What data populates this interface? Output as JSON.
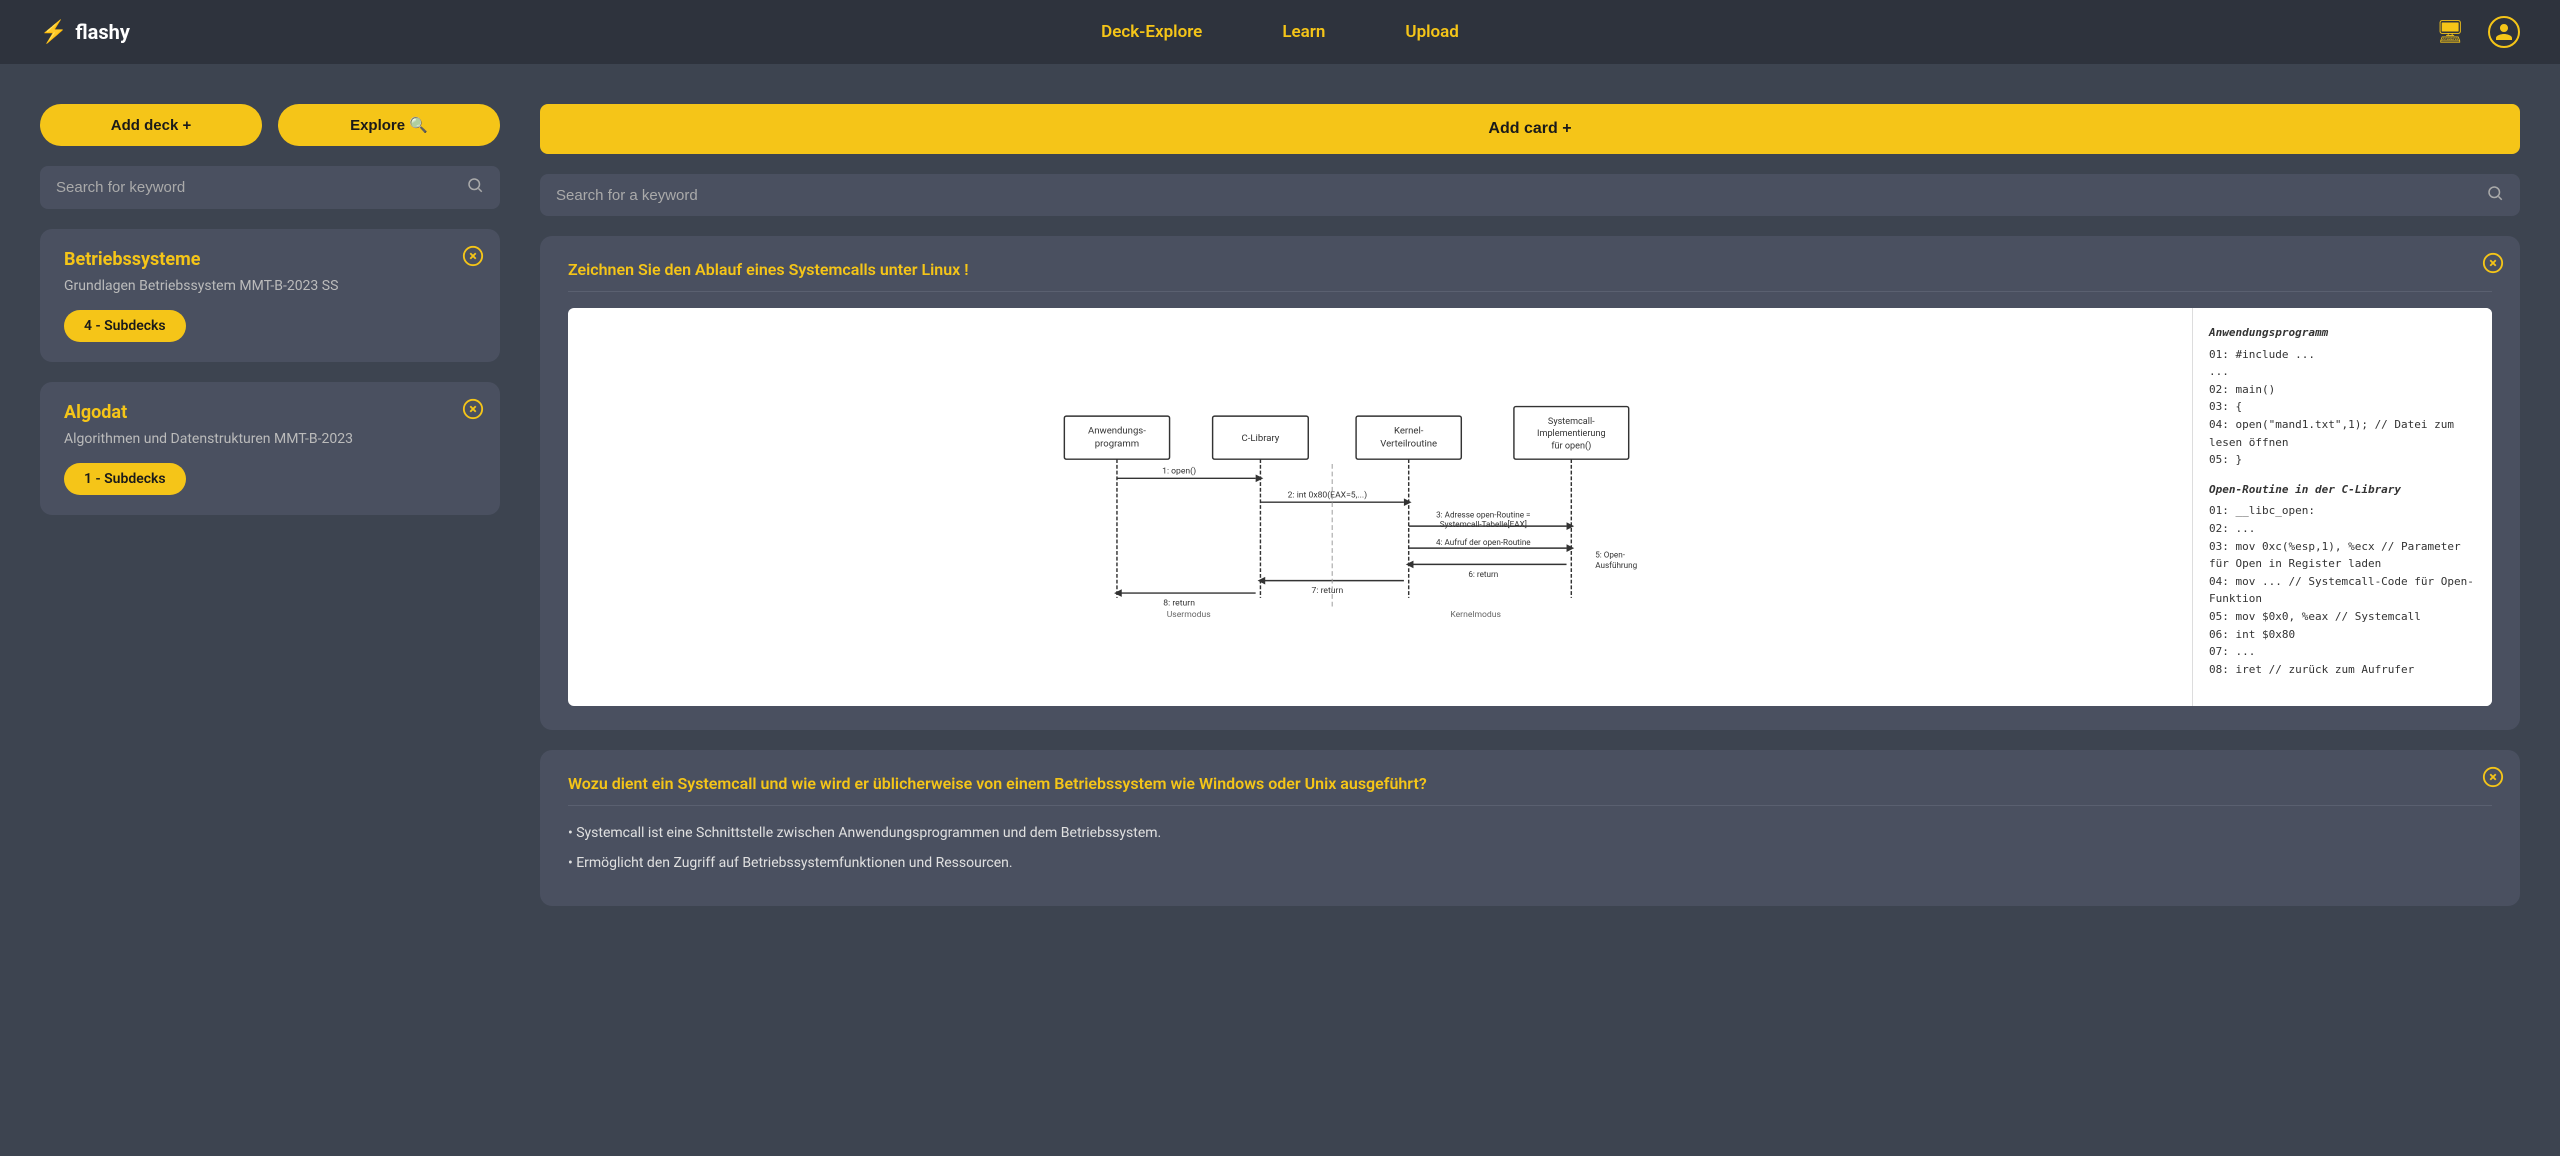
{
  "nav": {
    "logo_icon": "⚡",
    "logo_text": "flashy",
    "links": [
      {
        "label": "Deck-Explore",
        "id": "deck-explore"
      },
      {
        "label": "Learn",
        "id": "learn"
      },
      {
        "label": "Upload",
        "id": "upload"
      }
    ],
    "icons": [
      {
        "name": "presentation-icon",
        "glyph": "🖥"
      },
      {
        "name": "user-icon",
        "glyph": "👤"
      }
    ]
  },
  "left_panel": {
    "add_deck_label": "Add deck +",
    "explore_label": "Explore 🔍",
    "search_placeholder": "Search for keyword",
    "decks": [
      {
        "title": "Betriebssysteme",
        "subtitle": "Grundlagen Betriebssystem MMT-B-2023 SS",
        "badge": "4 - Subdecks"
      },
      {
        "title": "Algodat",
        "subtitle": "Algorithmen und Datenstrukturen MMT-B-2023",
        "badge": "1 - Subdecks"
      }
    ]
  },
  "right_panel": {
    "add_card_label": "Add card +",
    "search_placeholder": "Search for a keyword",
    "cards": [
      {
        "id": "card-1",
        "question": "Zeichnen Sie den Ablauf eines Systemcalls unter Linux !",
        "has_diagram": true,
        "diagram_code_title": "Anwendungsprogramm",
        "diagram_code_lines": [
          "01: #include ...",
          "   ...",
          "02: main()",
          "03: {",
          "04:  open(\"mand1.txt\",1);   // Datei zum lesen öffnen",
          "05: }"
        ],
        "diagram_lib_title": "Open-Routine in der C-Library",
        "diagram_lib_lines": [
          "01: __libc_open:",
          "02:  ...",
          "03: mov 0xc(%esp,1), %ecx   // Parameter für Open in Register laden",
          "04: mov  ...                // Systemcall-Code für Open-Funktion",
          "05: mov $0x0, %eax          // Systemcall",
          "06:  int $0x80",
          "07:  ...",
          "08: iret                    // zurück zum Aufrufer"
        ]
      },
      {
        "id": "card-2",
        "question": "Wozu dient ein Systemcall und wie wird er üblicherweise von einem Betriebssystem wie Windows oder Unix ausgeführt?",
        "has_diagram": false,
        "answer_lines": [
          "Systemcall ist eine Schnittstelle zwischen Anwendungsprogrammen und dem Betriebssystem.",
          "Ermöglicht den Zugriff auf Betriebssystemfunktionen und Ressourcen."
        ]
      }
    ]
  }
}
